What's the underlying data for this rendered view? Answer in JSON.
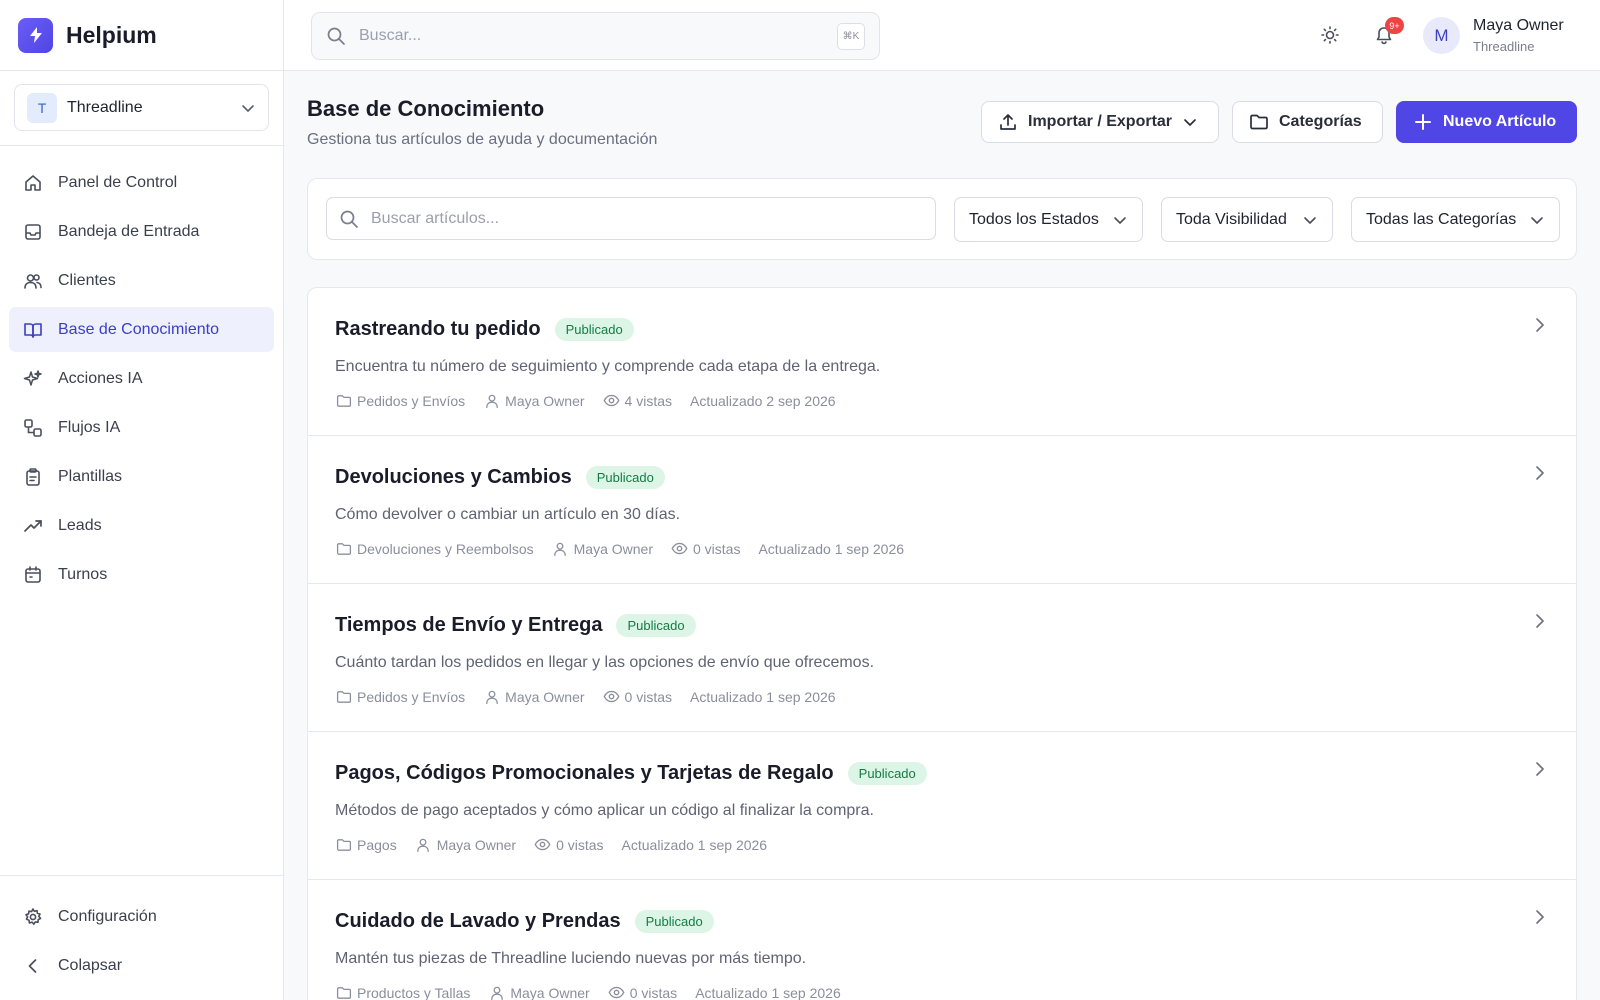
{
  "brand": {
    "name": "Helpium",
    "logo_icon": "bolt-icon",
    "logo_color": "#4f46e5"
  },
  "org": {
    "initial": "T",
    "name": "Threadline"
  },
  "nav": {
    "items": [
      {
        "label": "Panel de Control",
        "icon": "home-icon"
      },
      {
        "label": "Bandeja de Entrada",
        "icon": "inbox-icon"
      },
      {
        "label": "Clientes",
        "icon": "users-icon"
      },
      {
        "label": "Base de Conocimiento",
        "icon": "book-icon",
        "active": true
      },
      {
        "label": "Acciones IA",
        "icon": "sparkles-icon"
      },
      {
        "label": "Flujos IA",
        "icon": "workflow-icon"
      },
      {
        "label": "Plantillas",
        "icon": "clipboard-icon"
      },
      {
        "label": "Leads",
        "icon": "trending-up-icon"
      },
      {
        "label": "Turnos",
        "icon": "calendar-icon"
      }
    ],
    "bottom": [
      {
        "label": "Configuración",
        "icon": "gear-icon"
      },
      {
        "label": "Colapsar",
        "icon": "chevron-left-icon"
      }
    ]
  },
  "topbar": {
    "search_placeholder": "Buscar...",
    "shortcut": "⌘K",
    "notifications_badge": "9+",
    "user": {
      "initial": "M",
      "name": "Maya Owner",
      "org": "Threadline"
    }
  },
  "page": {
    "title": "Base de Conocimiento",
    "subtitle": "Gestiona tus artículos de ayuda y documentación",
    "actions": {
      "import_export": "Importar / Exportar",
      "categories": "Categorías",
      "new_article": "Nuevo Artículo"
    }
  },
  "filters": {
    "search_placeholder": "Buscar artículos...",
    "status": "Todos los Estados",
    "visibility": "Toda Visibilidad",
    "category": "Todas las Categorías"
  },
  "articles": [
    {
      "title": "Rastreando tu pedido",
      "status": "Publicado",
      "description": "Encuentra tu número de seguimiento y comprende cada etapa de la entrega.",
      "category": "Pedidos y Envíos",
      "author": "Maya Owner",
      "views": "4 vistas",
      "updated": "Actualizado 2 sep 2026"
    },
    {
      "title": "Devoluciones y Cambios",
      "status": "Publicado",
      "description": "Cómo devolver o cambiar un artículo en 30 días.",
      "category": "Devoluciones y Reembolsos",
      "author": "Maya Owner",
      "views": "0 vistas",
      "updated": "Actualizado 1 sep 2026"
    },
    {
      "title": "Tiempos de Envío y Entrega",
      "status": "Publicado",
      "description": "Cuánto tardan los pedidos en llegar y las opciones de envío que ofrecemos.",
      "category": "Pedidos y Envíos",
      "author": "Maya Owner",
      "views": "0 vistas",
      "updated": "Actualizado 1 sep 2026"
    },
    {
      "title": "Pagos, Códigos Promocionales y Tarjetas de Regalo",
      "status": "Publicado",
      "description": "Métodos de pago aceptados y cómo aplicar un código al finalizar la compra.",
      "category": "Pagos",
      "author": "Maya Owner",
      "views": "0 vistas",
      "updated": "Actualizado 1 sep 2026"
    },
    {
      "title": "Cuidado de Lavado y Prendas",
      "status": "Publicado",
      "description": "Mantén tus piezas de Threadline luciendo nuevas por más tiempo.",
      "category": "Productos y Tallas",
      "author": "Maya Owner",
      "views": "0 vistas",
      "updated": "Actualizado 1 sep 2026"
    }
  ],
  "colors": {
    "accent": "#4f46e5",
    "published_bg": "#dcf5e6",
    "published_text": "#167a44",
    "notification": "#ef4444"
  }
}
